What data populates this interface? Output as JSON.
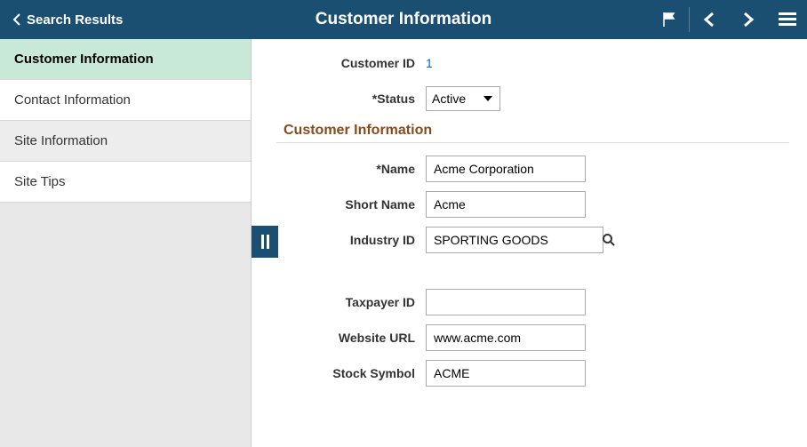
{
  "header": {
    "back_label": "Search Results",
    "title": "Customer Information"
  },
  "sidebar": {
    "items": [
      {
        "label": "Customer Information",
        "active": true
      },
      {
        "label": "Contact Information",
        "active": false
      },
      {
        "label": "Site Information",
        "active": false
      },
      {
        "label": "Site Tips",
        "active": false
      }
    ]
  },
  "form": {
    "customer_id_label": "Customer ID",
    "customer_id_value": "1",
    "status_label": "*Status",
    "status_value": "Active",
    "section_title": "Customer Information",
    "name_label": "*Name",
    "name_value": "Acme Corporation",
    "short_name_label": "Short Name",
    "short_name_value": "Acme",
    "industry_id_label": "Industry ID",
    "industry_id_value": "SPORTING GOODS",
    "taxpayer_id_label": "Taxpayer ID",
    "taxpayer_id_value": "",
    "website_url_label": "Website URL",
    "website_url_value": "www.acme.com",
    "stock_symbol_label": "Stock Symbol",
    "stock_symbol_value": "ACME"
  }
}
